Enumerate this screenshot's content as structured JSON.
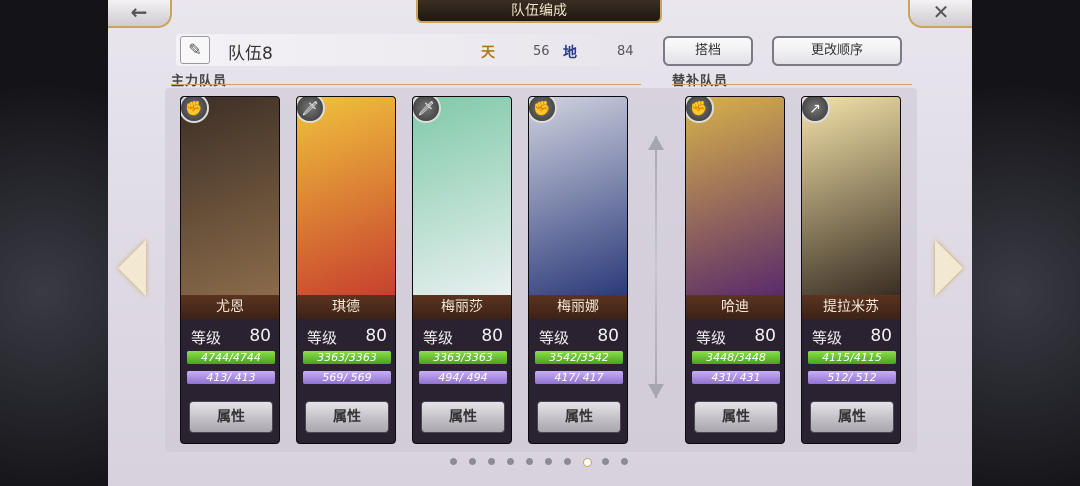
{
  "title": "队伍编成",
  "nav": {
    "back_icon": "←",
    "close_icon": "✕"
  },
  "team": {
    "name": "队伍8",
    "heaven_icon": "天",
    "heaven_value": "56",
    "earth_icon": "地",
    "earth_value": "84"
  },
  "buttons": {
    "partner": "搭档",
    "reorder": "更改顺序"
  },
  "sections": {
    "main": "主力队员",
    "sub": "替补队员"
  },
  "level_label": "等级",
  "attr_label": "属性",
  "colors": {
    "accent_gold": "#c9a45a",
    "hp": "#6cc13a",
    "mp": "#a98be4"
  },
  "main_members": [
    {
      "name": "尤恩",
      "level": "80",
      "hp": "4744/4744",
      "mp": "413/ 413",
      "weapon_icon": "fist-icon",
      "art": [
        "#3d2f26",
        "#8a6b4a"
      ]
    },
    {
      "name": "琪德",
      "level": "80",
      "hp": "3363/3363",
      "mp": "569/ 569",
      "weapon_icon": "dagger-icon",
      "art": [
        "#f0c23c",
        "#c7402e"
      ]
    },
    {
      "name": "梅丽莎",
      "level": "80",
      "hp": "3363/3363",
      "mp": "494/ 494",
      "weapon_icon": "dagger-icon",
      "art": [
        "#7fc9a8",
        "#e8f0f0"
      ]
    },
    {
      "name": "梅丽娜",
      "level": "80",
      "hp": "3542/3542",
      "mp": "417/ 417",
      "weapon_icon": "fist-icon",
      "art": [
        "#cfd2df",
        "#2c3a7a"
      ]
    }
  ],
  "sub_members": [
    {
      "name": "哈迪",
      "level": "80",
      "hp": "3448/3448",
      "mp": "431/ 431",
      "weapon_icon": "fist-icon",
      "art": [
        "#d9b24a",
        "#5a2a6a"
      ]
    },
    {
      "name": "提拉米苏",
      "level": "80",
      "hp": "4115/4115",
      "mp": "512/ 512",
      "weapon_icon": "spear-icon",
      "art": [
        "#f3e2a8",
        "#3a2e24"
      ]
    }
  ],
  "pagination": {
    "total": 10,
    "active_index": 7
  }
}
